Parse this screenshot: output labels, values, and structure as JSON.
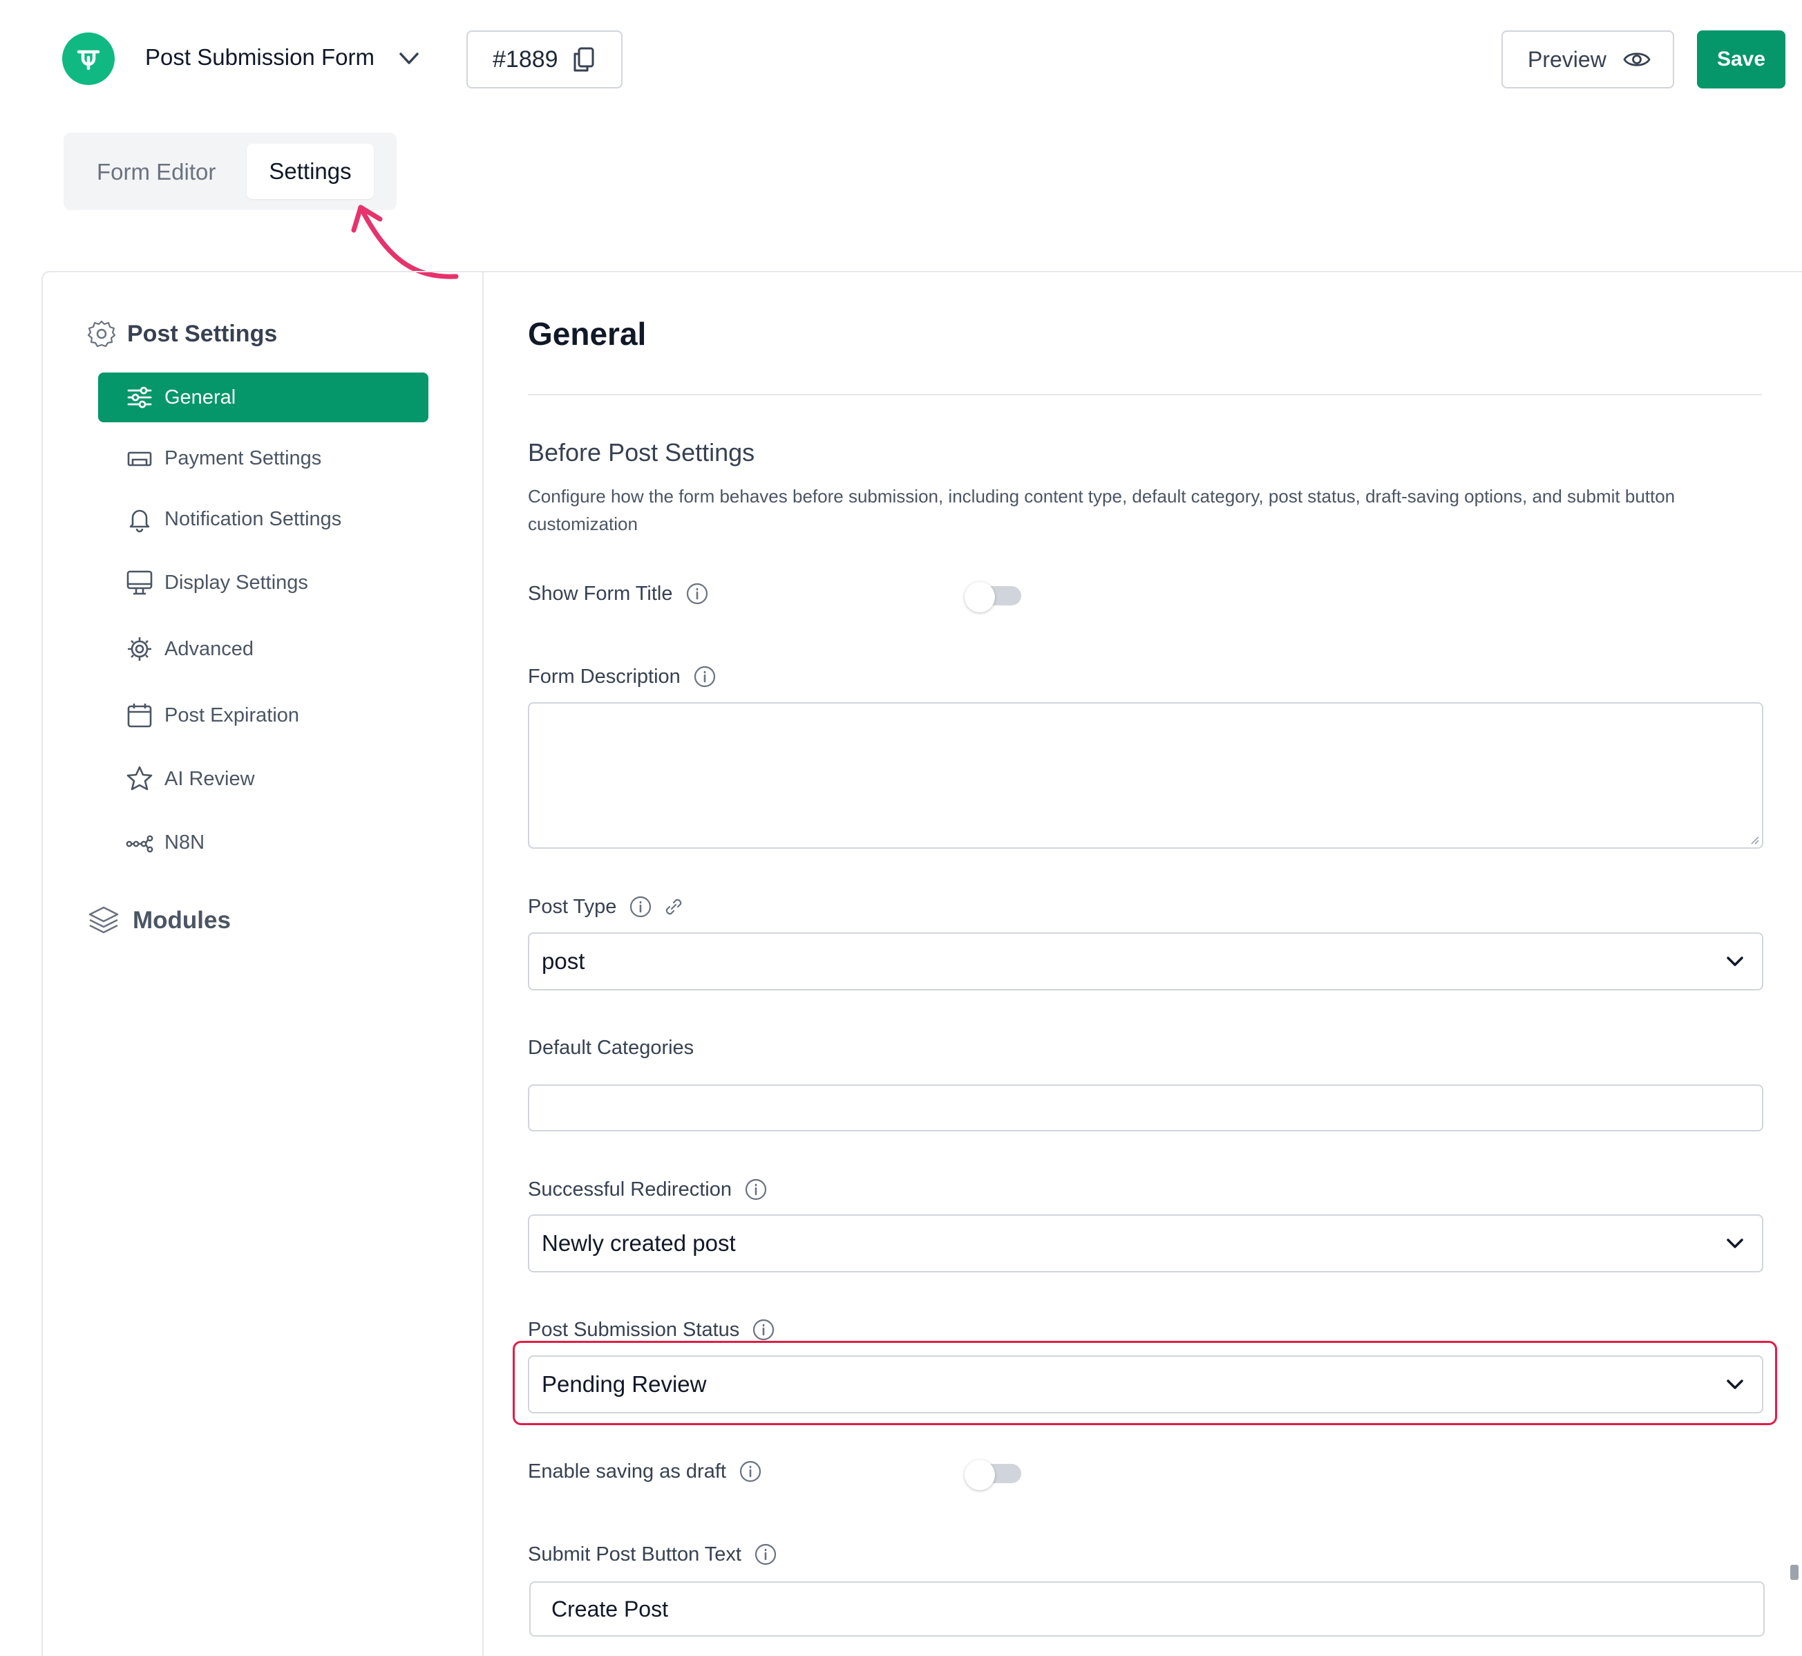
{
  "header": {
    "form_name": "Post Submission Form",
    "form_id": "#1889",
    "preview_label": "Preview",
    "save_label": "Save"
  },
  "tabs": [
    {
      "label": "Form Editor",
      "active": false
    },
    {
      "label": "Settings",
      "active": true
    }
  ],
  "sidebar": {
    "section_title": "Post Settings",
    "items": [
      {
        "label": "General",
        "icon": "sliders-icon",
        "active": true
      },
      {
        "label": "Payment Settings",
        "icon": "payment-icon",
        "active": false
      },
      {
        "label": "Notification Settings",
        "icon": "bell-icon",
        "active": false
      },
      {
        "label": "Display Settings",
        "icon": "monitor-icon",
        "active": false
      },
      {
        "label": "Advanced",
        "icon": "cog-icon",
        "active": false
      },
      {
        "label": "Post Expiration",
        "icon": "calendar-icon",
        "active": false
      },
      {
        "label": "AI Review",
        "icon": "star-icon",
        "active": false
      },
      {
        "label": "N8N",
        "icon": "n8n-icon",
        "active": false
      }
    ],
    "modules_label": "Modules"
  },
  "content": {
    "title": "General",
    "section_title": "Before Post Settings",
    "section_description": "Configure how the form behaves before submission, including content type, default category, post status, draft-saving options, and submit button customization",
    "fields": {
      "show_form_title": {
        "label": "Show Form Title",
        "enabled": false
      },
      "form_description": {
        "label": "Form Description",
        "value": ""
      },
      "post_type": {
        "label": "Post Type",
        "value": "post"
      },
      "default_categories": {
        "label": "Default Categories",
        "value": ""
      },
      "successful_redirection": {
        "label": "Successful Redirection",
        "value": "Newly created post"
      },
      "post_submission_status": {
        "label": "Post Submission Status",
        "value": "Pending Review"
      },
      "enable_saving_draft": {
        "label": "Enable saving as draft",
        "enabled": false
      },
      "submit_button_text": {
        "label": "Submit Post Button Text",
        "value": "Create Post"
      }
    }
  },
  "colors": {
    "brand_green": "#059669",
    "logo_green": "#10b981",
    "highlight": "#e11d48"
  }
}
